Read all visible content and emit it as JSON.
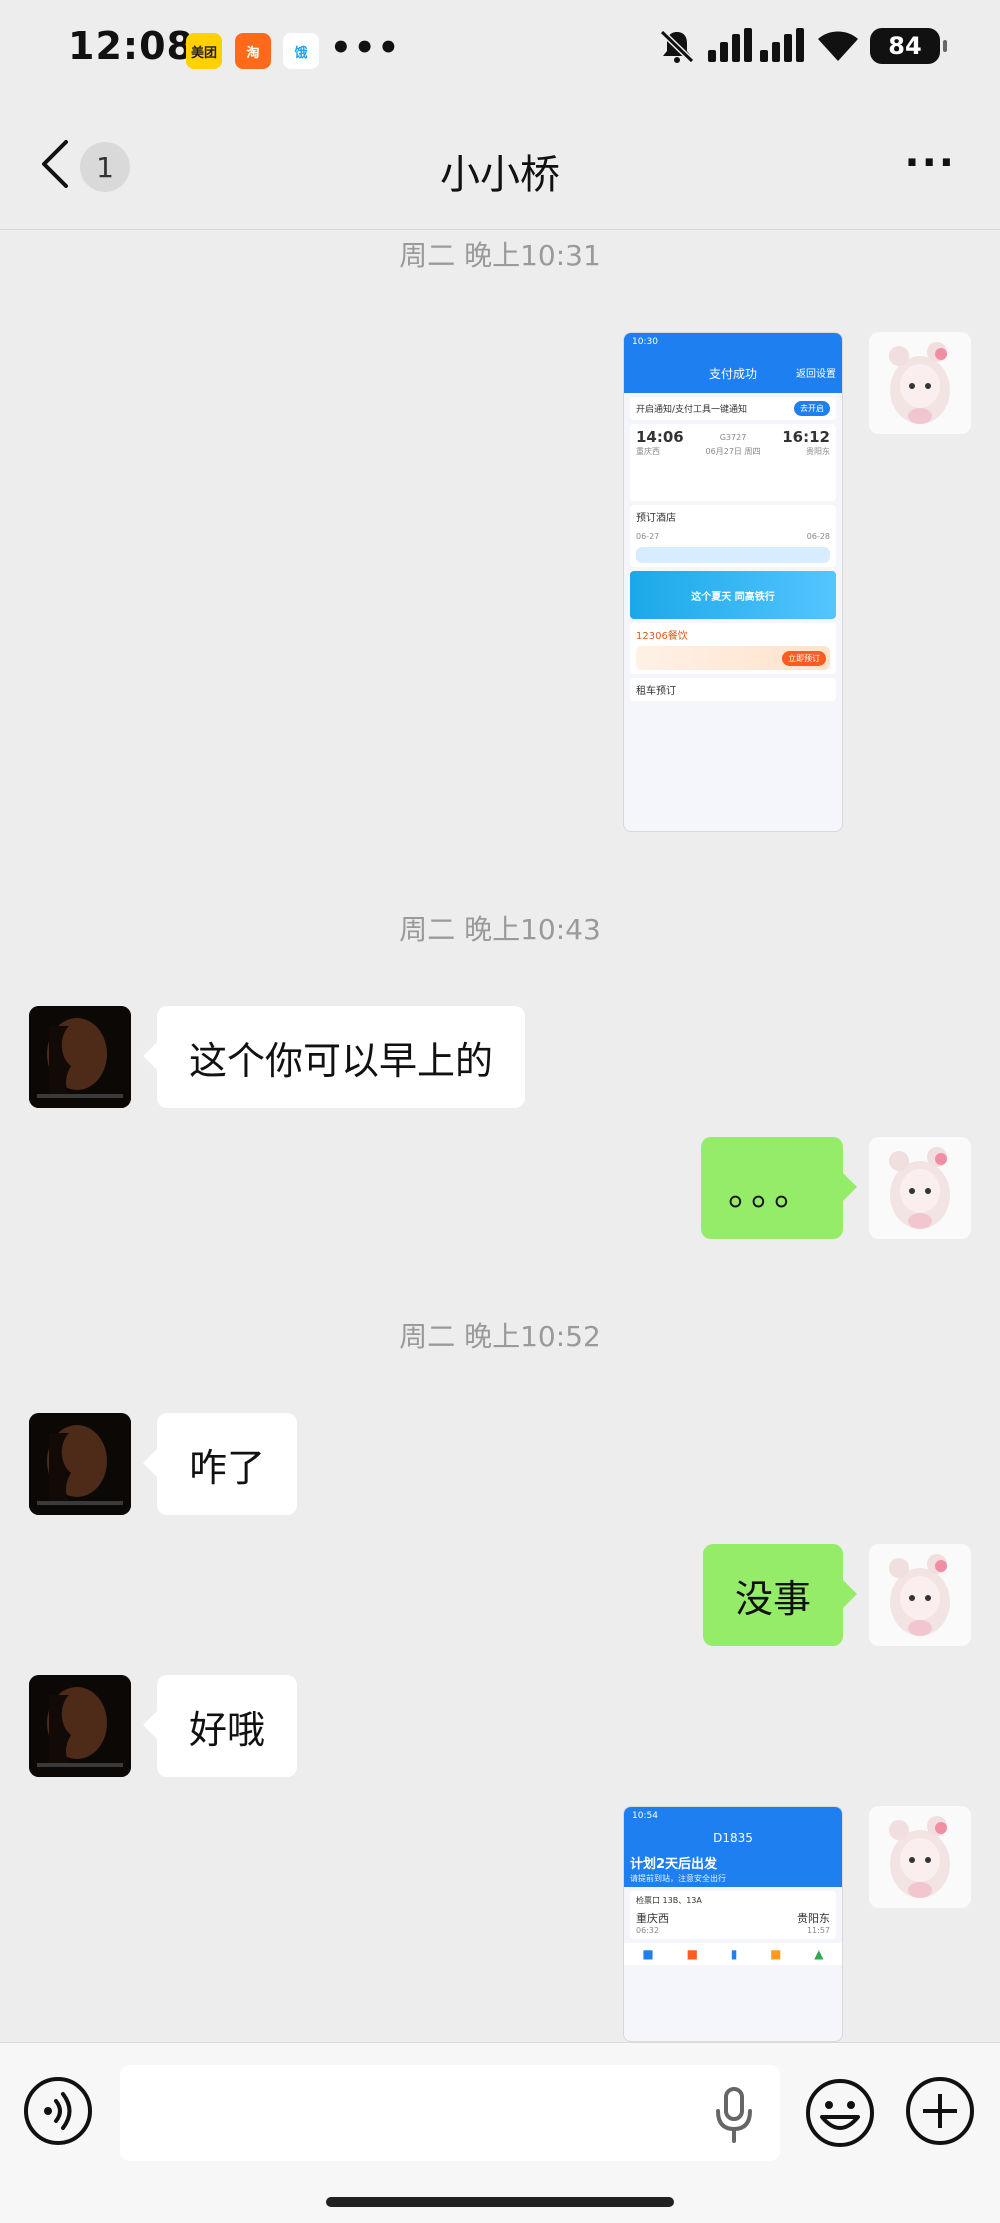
{
  "status_bar": {
    "time": "12:08",
    "app_icons": [
      "美团",
      "淘",
      "饿"
    ],
    "overflow": "•••",
    "battery": "84",
    "icons": [
      "mute-icon",
      "signal-icon",
      "wifi-icon",
      "battery-icon"
    ]
  },
  "header": {
    "back_icon": "chevron-left-icon",
    "unread_count": "1",
    "title": "小小桥",
    "more_label": "···"
  },
  "messages": {
    "ts1": "周二 晚上10:31",
    "ts2": "周二 晚上10:43",
    "ts3": "周二 晚上10:52",
    "m1": "这个你可以早上的",
    "m2": "。。。",
    "m3": "咋了",
    "m4": "没事",
    "m5": "好哦"
  },
  "image1": {
    "status": "10:30",
    "title": "支付成功",
    "right": "返回设置",
    "notice": "开启通知/支付工具一键通知",
    "notice_btn": "去开启",
    "dep_time": "14:06",
    "train": "G3727",
    "arr_time": "16:12",
    "dep_station": "重庆西",
    "arr_station": "贵阳东",
    "duration": "06月27日 周四",
    "hotel": "预订酒店",
    "date_from": "06-27",
    "date_to": "06-28",
    "banner": "这个夏天 同高铁行",
    "food": "12306餐饮",
    "food_btn": "立即预订",
    "car": "租车预订"
  },
  "image2": {
    "status": "10:54",
    "train": "D1835",
    "headline": "计划2天后出发",
    "sub": "请提前到站，注意安全出行",
    "gate": "检票口 13B、13A",
    "dep_station": "重庆西",
    "arr_station": "贵阳东",
    "dep_time": "06:32",
    "arr_time": "11:57"
  },
  "input": {
    "placeholder": ""
  },
  "colors": {
    "bg": "#ededed",
    "me_bubble": "#95ec69",
    "other_bubble": "#ffffff"
  }
}
